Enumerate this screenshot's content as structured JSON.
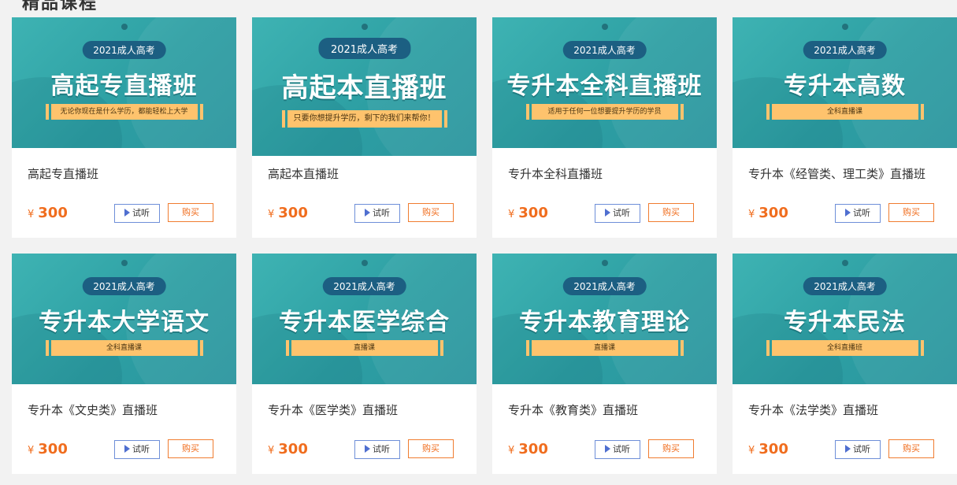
{
  "section": {
    "title": "精品课程"
  },
  "courses": [
    {
      "pill": "2021成人高考",
      "headline": "高起专直播班",
      "strip": "无论你现在是什么学历，都能轻松上大学",
      "title": "高起专直播班",
      "price": "300",
      "currency": "¥",
      "try_label": "试听",
      "buy_label": "购买"
    },
    {
      "pill": "2021成人高考",
      "headline": "高起本直播班",
      "strip": "只要你想提升学历，剩下的我们来帮你！",
      "title": "高起本直播班",
      "price": "300",
      "currency": "¥",
      "try_label": "试听",
      "buy_label": "购买"
    },
    {
      "pill": "2021成人高考",
      "headline": "专升本全科直播班",
      "strip": "适用于任何一位想要提升学历的学员",
      "title": "专升本全科直播班",
      "price": "300",
      "currency": "¥",
      "try_label": "试听",
      "buy_label": "购买"
    },
    {
      "pill": "2021成人高考",
      "headline": "专升本高数",
      "strip": "全科直播课",
      "title": "专升本《经管类、理工类》直播班",
      "price": "300",
      "currency": "¥",
      "try_label": "试听",
      "buy_label": "购买"
    },
    {
      "pill": "2021成人高考",
      "headline": "专升本大学语文",
      "strip": "全科直播课",
      "title": "专升本《文史类》直播班",
      "price": "300",
      "currency": "¥",
      "try_label": "试听",
      "buy_label": "购买"
    },
    {
      "pill": "2021成人高考",
      "headline": "专升本医学综合",
      "strip": "直播课",
      "title": "专升本《医学类》直播班",
      "price": "300",
      "currency": "¥",
      "try_label": "试听",
      "buy_label": "购买"
    },
    {
      "pill": "2021成人高考",
      "headline": "专升本教育理论",
      "strip": "直播课",
      "title": "专升本《教育类》直播班",
      "price": "300",
      "currency": "¥",
      "try_label": "试听",
      "buy_label": "购买"
    },
    {
      "pill": "2021成人高考",
      "headline": "专升本民法",
      "strip": "全科直播班",
      "title": "专升本《法学类》直播班",
      "price": "300",
      "currency": "¥",
      "try_label": "试听",
      "buy_label": "购买"
    }
  ],
  "colors": {
    "banner": "#2d9fa3",
    "pill": "#1c5f82",
    "strip": "#fec36d",
    "price": "#f06d1e",
    "try_border": "#6e8fd8",
    "buy_border": "#f07c30"
  }
}
